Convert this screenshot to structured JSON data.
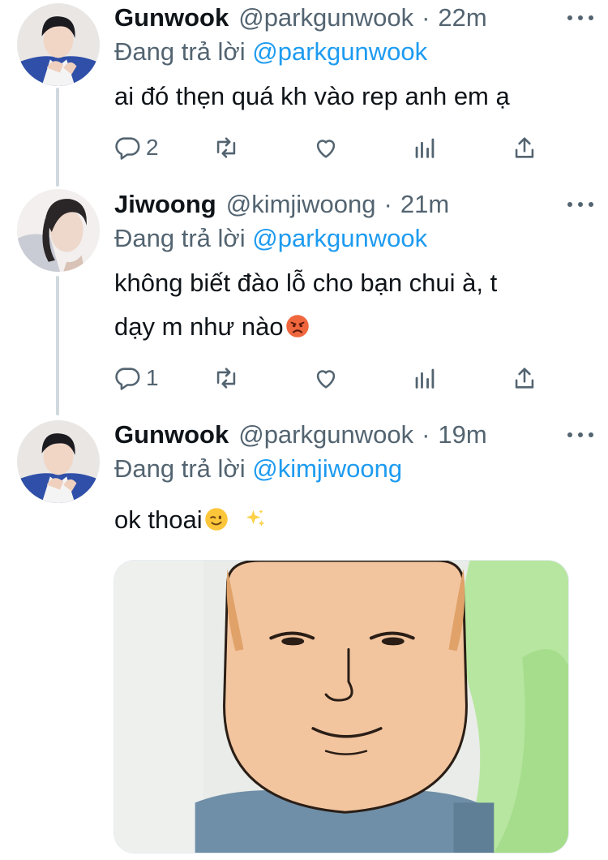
{
  "tweets": [
    {
      "name": "Gunwook",
      "handle": "@parkgunwook",
      "separator": "·",
      "time": "22m",
      "reply_prefix": "Đang trả lời",
      "reply_mention": "@parkgunwook",
      "text": "ai đó thẹn quá kh vào rep anh em ạ",
      "reply_count": "2",
      "avatar": "gunwook-avatar"
    },
    {
      "name": "Jiwoong",
      "handle": "@kimjiwoong",
      "separator": "·",
      "time": "21m",
      "reply_prefix": "Đang trả lời",
      "reply_mention": "@parkgunwook",
      "text_line1": "không biết đào lỗ cho bạn chui à, t",
      "text_line2": "dạy m như nào",
      "text_emoji": "angry-face-emoji",
      "reply_count": "1",
      "avatar": "jiwoong-avatar"
    },
    {
      "name": "Gunwook",
      "handle": "@parkgunwook",
      "separator": "·",
      "time": "19m",
      "reply_prefix": "Đang trả lời",
      "reply_mention": "@kimjiwoong",
      "text": "ok thoai",
      "text_emojis": [
        "winking-face-emoji",
        "sparkles-emoji"
      ],
      "media": "cartoon-face-image",
      "avatar": "gunwook-avatar"
    }
  ],
  "icons": [
    "reply-icon",
    "retweet-icon",
    "like-icon",
    "analytics-icon",
    "share-icon",
    "more-icon"
  ],
  "colors": {
    "text": "#0f1419",
    "secondary": "#536471",
    "link": "#1d9bf0",
    "thread_line": "#cfd9de"
  }
}
